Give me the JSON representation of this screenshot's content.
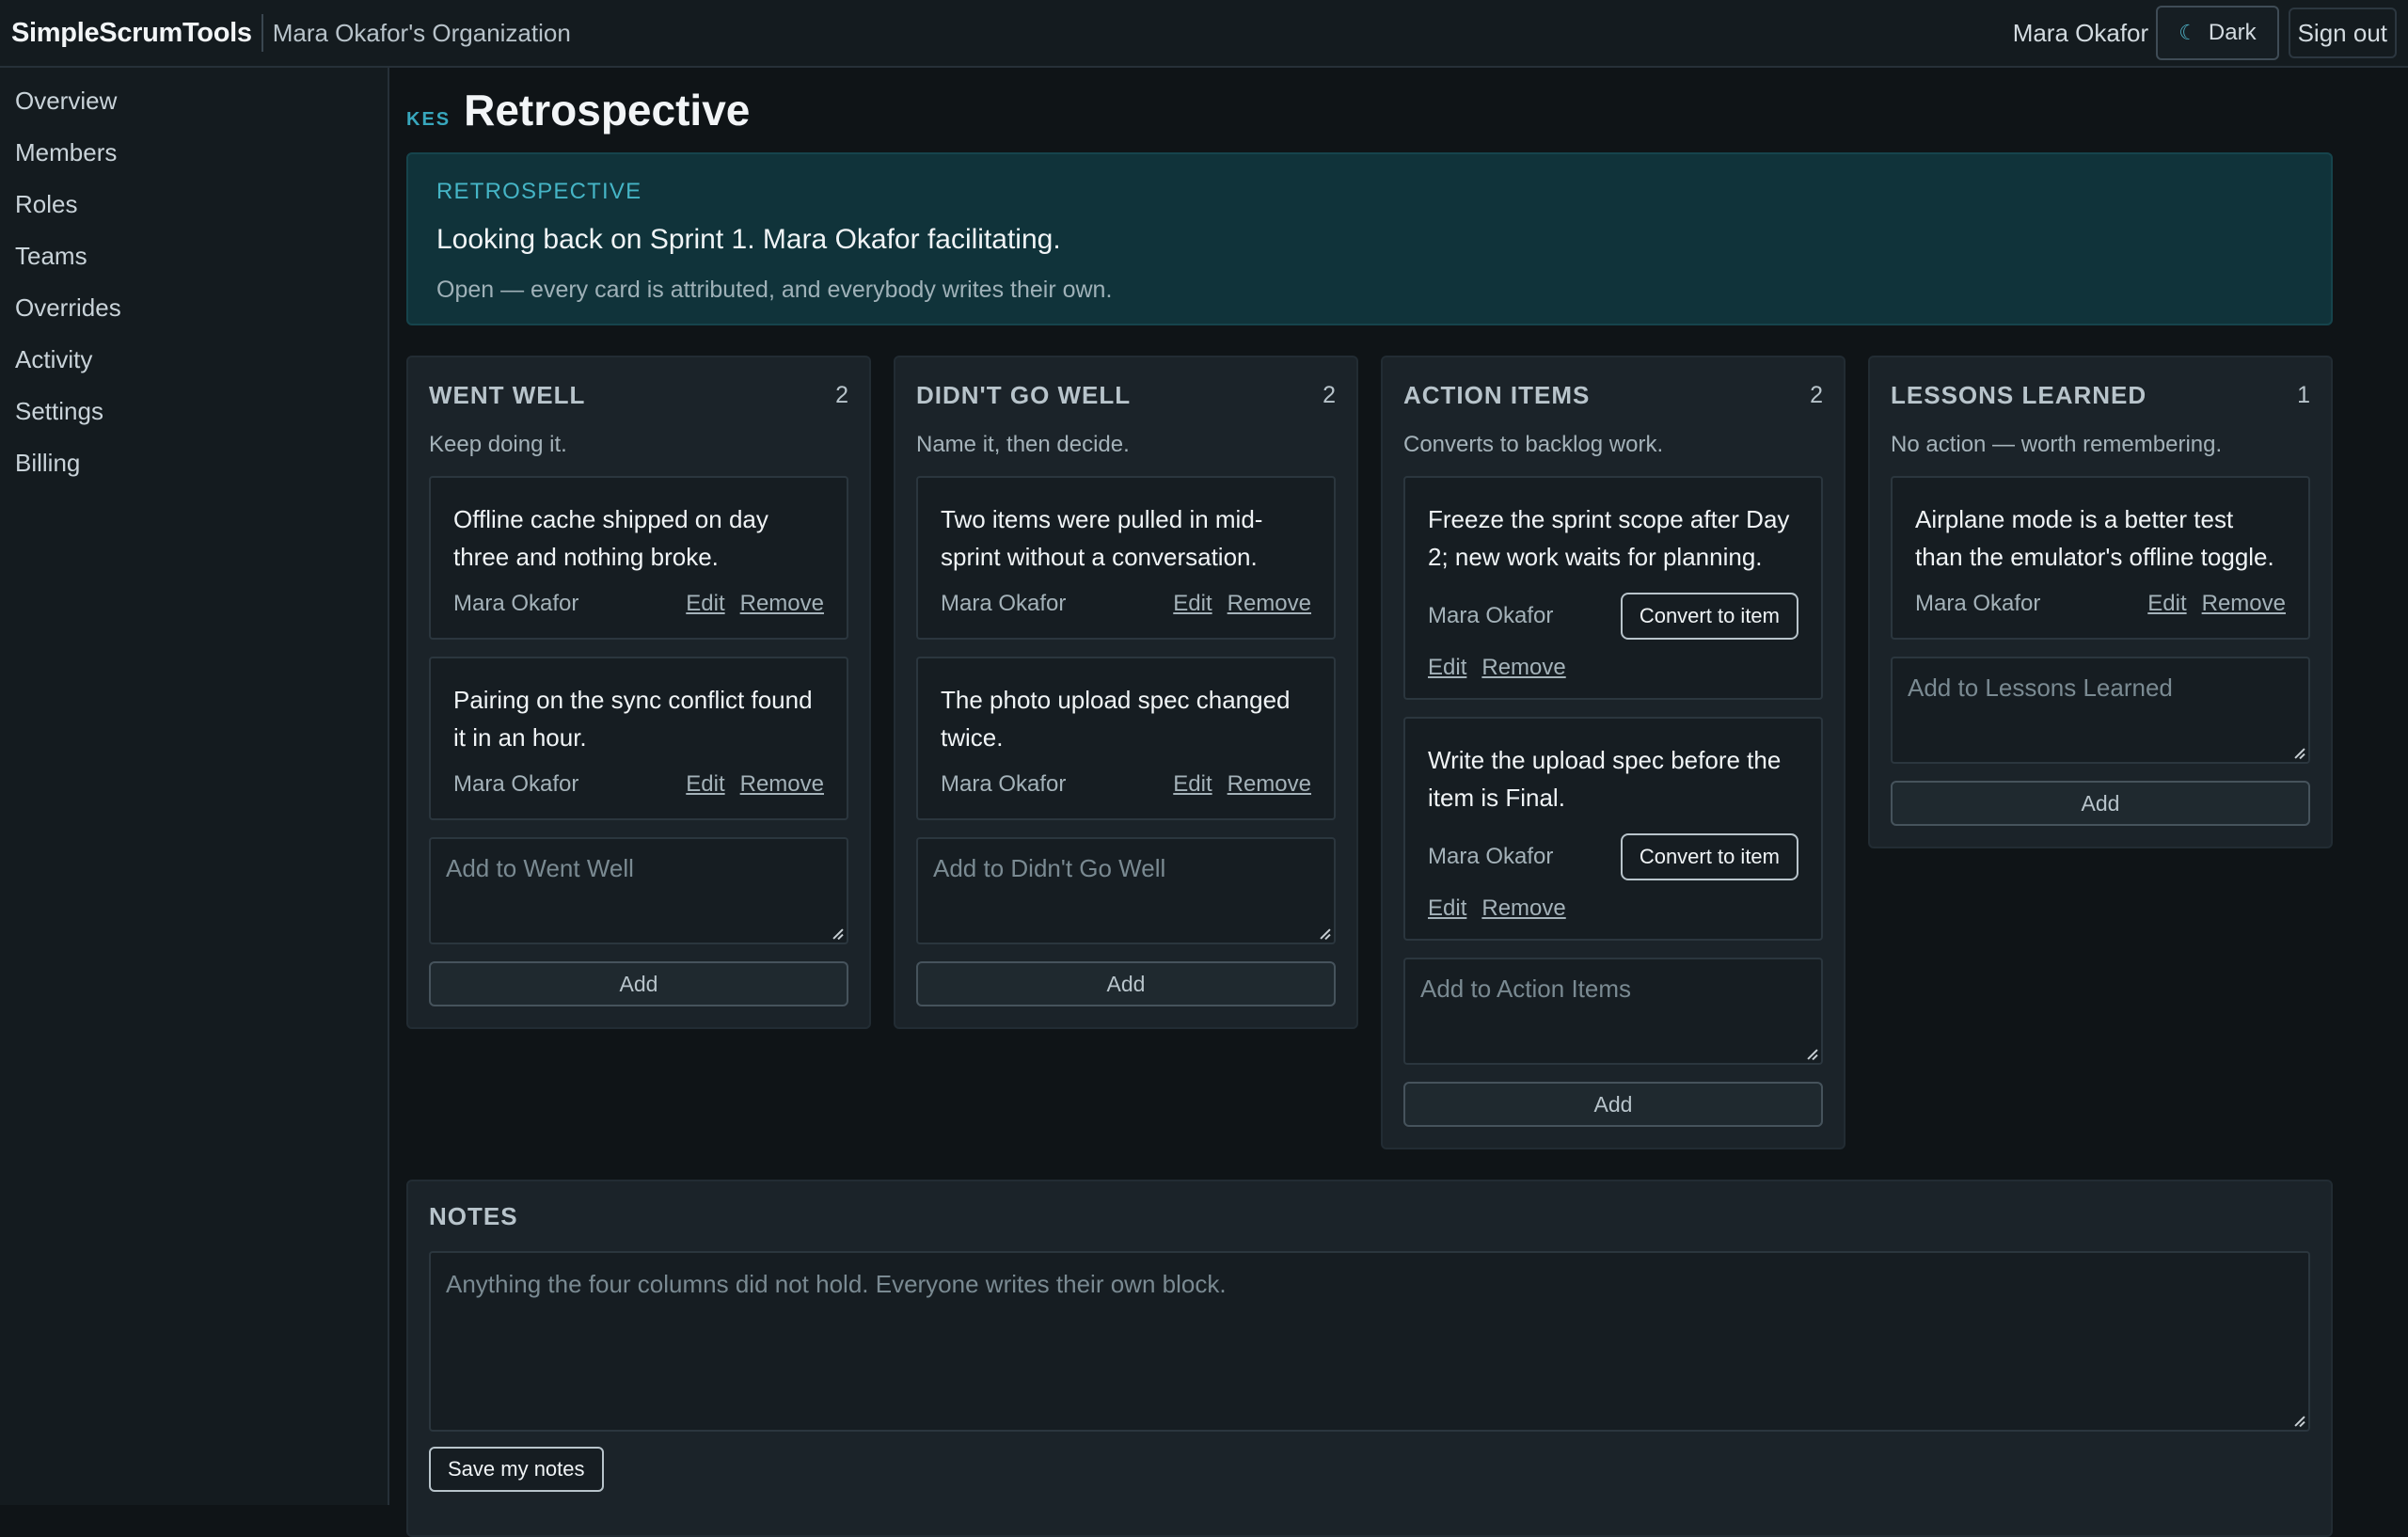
{
  "header": {
    "brand": "SimpleScrumTools",
    "org": "Mara Okafor's Organization",
    "user": "Mara Okafor",
    "theme_icon": "moon-icon",
    "theme_glyph": "☾",
    "theme_label": "Dark",
    "signout_label": "Sign out"
  },
  "sidebar": {
    "items": [
      {
        "label": "Overview"
      },
      {
        "label": "Members"
      },
      {
        "label": "Roles"
      },
      {
        "label": "Teams"
      },
      {
        "label": "Overrides"
      },
      {
        "label": "Activity"
      },
      {
        "label": "Settings"
      },
      {
        "label": "Billing"
      }
    ]
  },
  "page": {
    "code": "KES",
    "title": "Retrospective"
  },
  "hero": {
    "kicker": "RETROSPECTIVE",
    "line": "Looking back on Sprint 1. Mara Okafor facilitating.",
    "sub": "Open — every card is attributed, and everybody writes their own."
  },
  "columns": [
    {
      "title": "WENT WELL",
      "count": "2",
      "desc": "Keep doing it.",
      "cards": [
        {
          "text": "Offline cache shipped on day three and nothing broke.",
          "author": "Mara Okafor",
          "edit": "Edit",
          "remove": "Remove"
        },
        {
          "text": "Pairing on the sync conflict found it in an hour.",
          "author": "Mara Okafor",
          "edit": "Edit",
          "remove": "Remove"
        }
      ],
      "add_placeholder": "Add to Went Well",
      "add_label": "Add"
    },
    {
      "title": "DIDN'T GO WELL",
      "count": "2",
      "desc": "Name it, then decide.",
      "cards": [
        {
          "text": "Two items were pulled in mid-sprint without a conversation.",
          "author": "Mara Okafor",
          "edit": "Edit",
          "remove": "Remove"
        },
        {
          "text": "The photo upload spec changed twice.",
          "author": "Mara Okafor",
          "edit": "Edit",
          "remove": "Remove"
        }
      ],
      "add_placeholder": "Add to Didn't Go Well",
      "add_label": "Add"
    },
    {
      "title": "ACTION ITEMS",
      "count": "2",
      "desc": "Converts to backlog work.",
      "cards": [
        {
          "text": "Freeze the sprint scope after Day 2; new work waits for planning.",
          "author": "Mara Okafor",
          "convert": "Convert to item",
          "edit": "Edit",
          "remove": "Remove"
        },
        {
          "text": "Write the upload spec before the item is Final.",
          "author": "Mara Okafor",
          "convert": "Convert to item",
          "edit": "Edit",
          "remove": "Remove"
        }
      ],
      "add_placeholder": "Add to Action Items",
      "add_label": "Add"
    },
    {
      "title": "LESSONS LEARNED",
      "count": "1",
      "desc": "No action — worth remembering.",
      "cards": [
        {
          "text": "Airplane mode is a better test than the emulator's offline toggle.",
          "author": "Mara Okafor",
          "edit": "Edit",
          "remove": "Remove"
        }
      ],
      "add_placeholder": "Add to Lessons Learned",
      "add_label": "Add"
    }
  ],
  "notes": {
    "title": "NOTES",
    "placeholder": "Anything the four columns did not hold. Everyone writes their own block.",
    "save_label": "Save my notes"
  }
}
